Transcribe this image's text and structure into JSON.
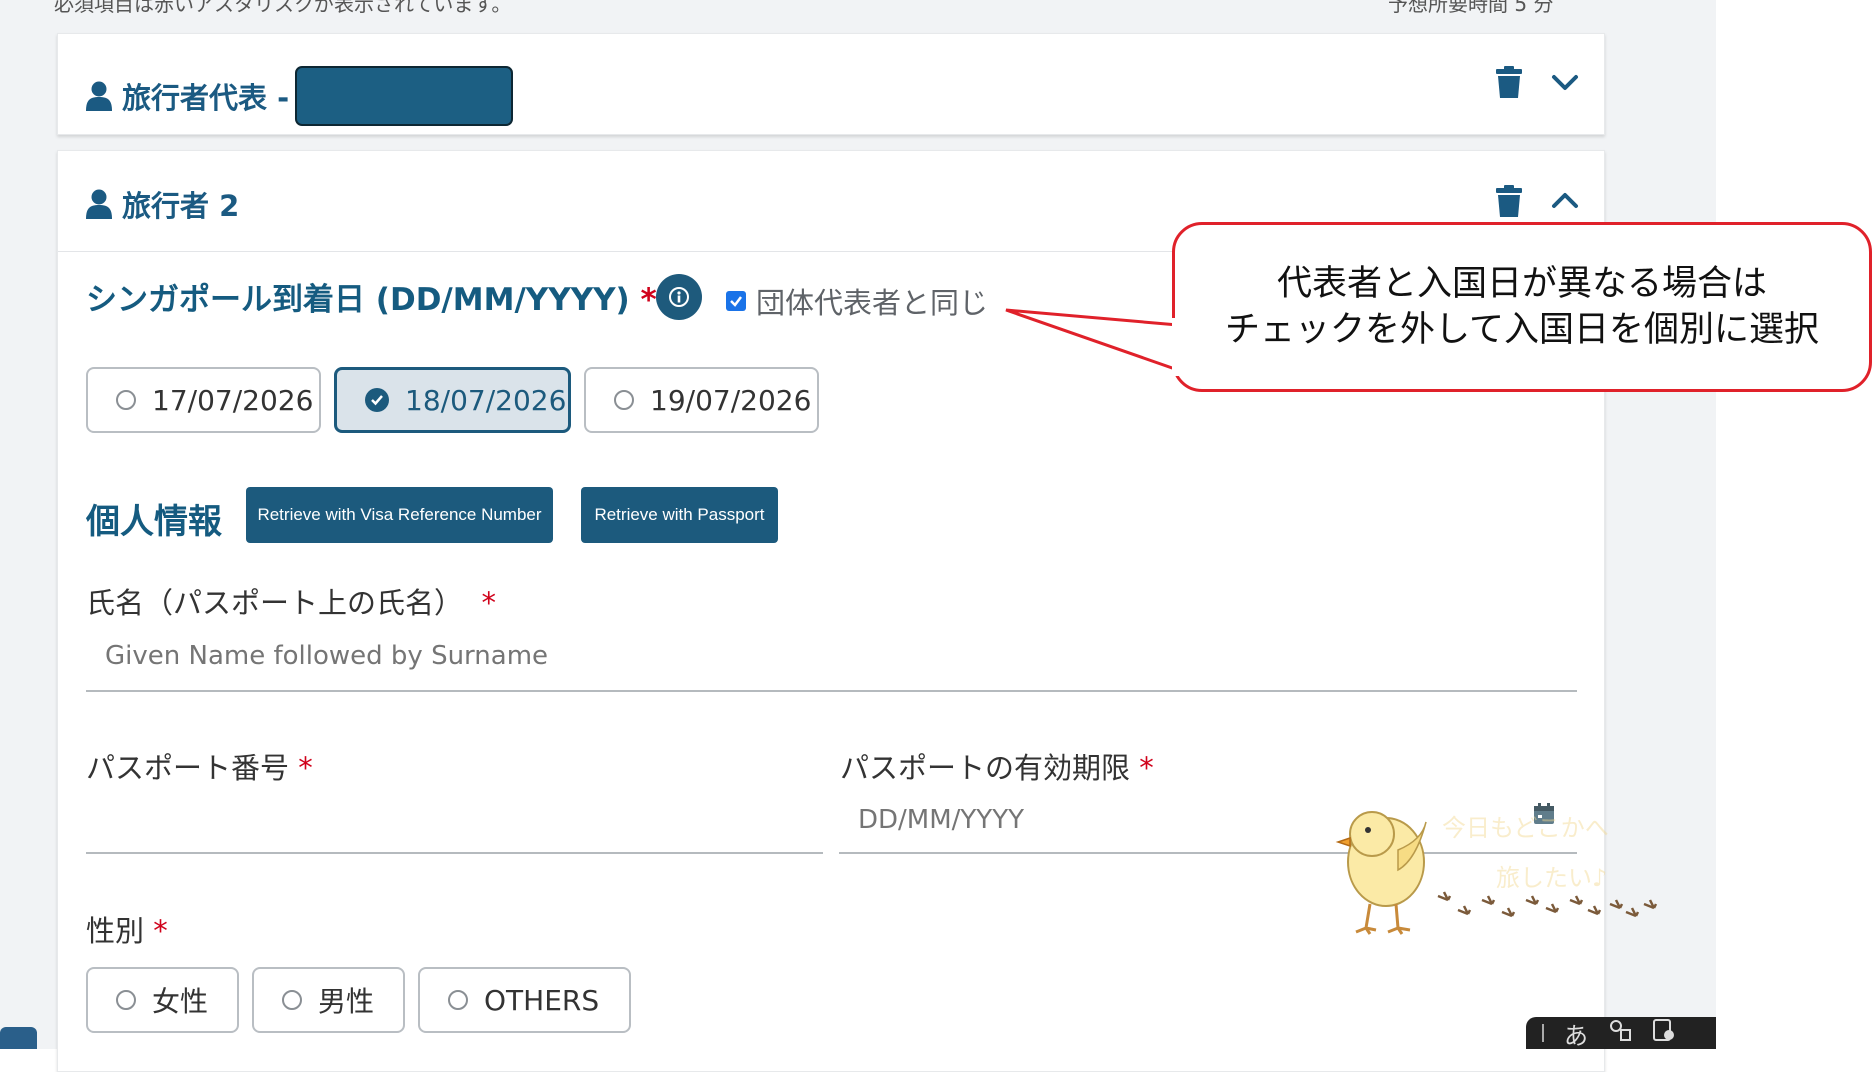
{
  "top_strip": {
    "left_text": "必須項目は赤いアスタリスクが表示されています。",
    "right_text": "予想所要時間 5 分"
  },
  "traveller_rep": {
    "title": "旅行者代表 -"
  },
  "traveller_2": {
    "title": "旅行者 2"
  },
  "arrival": {
    "label": "シンガポール到着日 (DD/MM/YYYY)",
    "required_mark": "*",
    "same_as_group_label": "団体代表者と同じ",
    "same_as_group_checked": true,
    "dates": [
      {
        "label": "17/07/2026",
        "selected": false
      },
      {
        "label": "18/07/2026",
        "selected": true
      },
      {
        "label": "19/07/2026",
        "selected": false
      }
    ]
  },
  "personal_info": {
    "heading": "個人情報",
    "retrieve_visa_label": "Retrieve with Visa Reference Number",
    "retrieve_passport_label": "Retrieve with Passport"
  },
  "name_field": {
    "label": "氏名（パスポート上の氏名）",
    "required_mark": "*",
    "placeholder": "Given Name followed by Surname"
  },
  "passport_number": {
    "label": "パスポート番号",
    "required_mark": "*",
    "value": ""
  },
  "passport_expiry": {
    "label": "パスポートの有効期限",
    "required_mark": "*",
    "placeholder": "DD/MM/YYYY"
  },
  "gender": {
    "label": "性別",
    "required_mark": "*",
    "options": [
      "女性",
      "男性",
      "OTHERS"
    ]
  },
  "callout": {
    "line1": "代表者と入国日が異なる場合は",
    "line2": "チェックを外して入国日を個別に選択"
  },
  "watermark": {
    "line1": "今日もどこかへ",
    "line2": "旅したい♪"
  },
  "ime_bar": {
    "kana": "あ"
  },
  "colors": {
    "primary": "#1c5a7d",
    "required": "#d0021b",
    "callout_border": "#e0212a",
    "checkbox": "#1a73e8"
  },
  "icons": [
    "person-icon",
    "trash-icon",
    "chevron-down-icon",
    "chevron-up-icon",
    "info-icon",
    "check-icon",
    "calendar-icon"
  ]
}
